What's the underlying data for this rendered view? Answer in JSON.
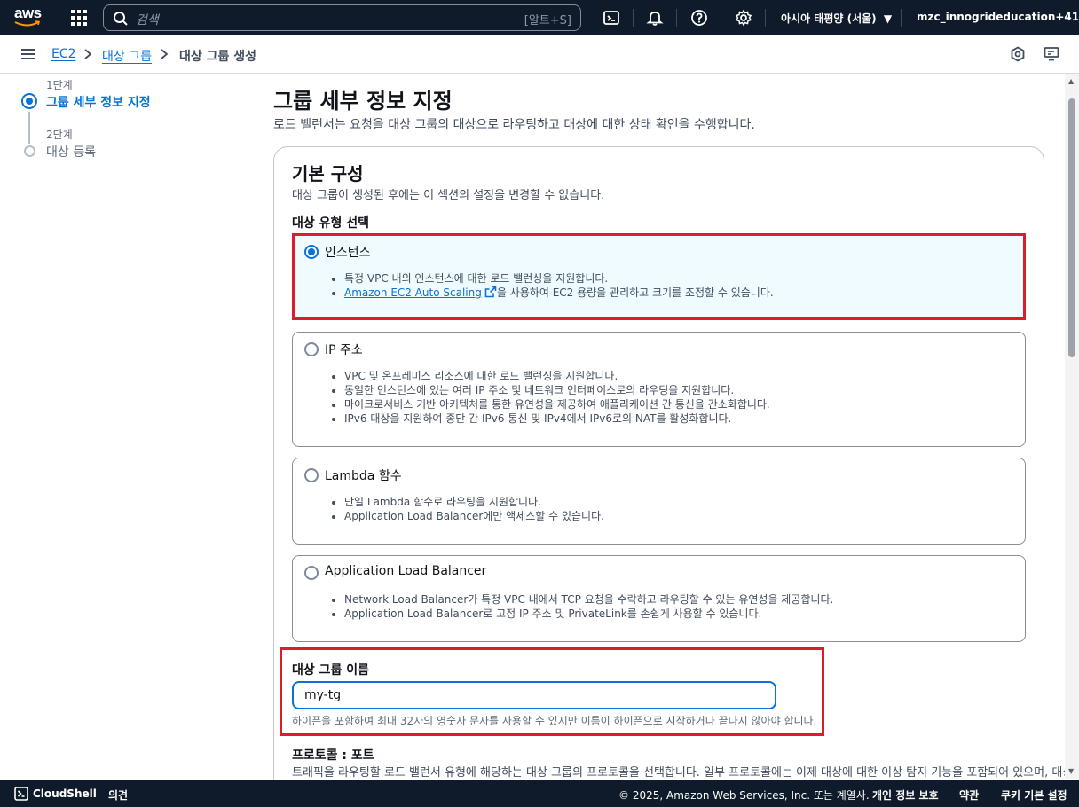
{
  "topnav": {
    "logo_text": "aws",
    "search_placeholder": "검색",
    "search_shortcut": "[알트+S]",
    "region": "아시아 태평양 (서울)",
    "account": "mzc_innogrideducation+41"
  },
  "breadcrumb": {
    "items": [
      "EC2",
      "대상 그룹",
      "대상 그룹 생성"
    ]
  },
  "steps": [
    {
      "number": "1단계",
      "label": "그룹 세부 정보 지정"
    },
    {
      "number": "2단계",
      "label": "대상 등록"
    }
  ],
  "main": {
    "title": "그룹 세부 정보 지정",
    "description": "로드 밸런서는 요청을 대상 그룹의 대상으로 라우팅하고 대상에 대한 상태 확인을 수행합니다."
  },
  "basic_config": {
    "title": "기본 구성",
    "description": "대상 그룹이 생성된 후에는 이 섹션의 설정을 변경할 수 없습니다.",
    "target_type_label": "대상 유형 선택",
    "options": [
      {
        "title": "인스턴스",
        "selected": true,
        "bullets": [
          "특정 VPC 내의 인스턴스에 대한 로드 밸런싱을 지원합니다."
        ],
        "link_text": "Amazon EC2 Auto Scaling",
        "link_suffix": "을 사용하여 EC2 용량을 관리하고 크기를 조정할 수 있습니다."
      },
      {
        "title": "IP 주소",
        "selected": false,
        "bullets": [
          "VPC 및 온프레미스 리소스에 대한 로드 밸런싱을 지원합니다.",
          "동일한 인스턴스에 있는 여러 IP 주소 및 네트워크 인터페이스로의 라우팅을 지원합니다.",
          "마이크로서비스 기반 아키텍처를 통한 유연성을 제공하여 애플리케이션 간 통신을 간소화합니다.",
          "IPv6 대상을 지원하여 종단 간 IPv6 통신 및 IPv4에서 IPv6로의 NAT를 활성화합니다."
        ]
      },
      {
        "title": "Lambda 함수",
        "selected": false,
        "bullets": [
          "단일 Lambda 함수로 라우팅을 지원합니다.",
          "Application Load Balancer에만 액세스할 수 있습니다."
        ]
      },
      {
        "title": "Application Load Balancer",
        "selected": false,
        "bullets": [
          "Network Load Balancer가 특정 VPC 내에서 TCP 요청을 수락하고 라우팅할 수 있는 유연성을 제공합니다.",
          "Application Load Balancer로 고정 IP 주소 및 PrivateLink를 손쉽게 사용할 수 있습니다."
        ]
      }
    ],
    "name_label": "대상 그룹 이름",
    "name_value": "my-tg",
    "name_hint": "하이픈을 포함하여 최대 32자의 영숫자 문자를 사용할 수 있지만 이름이 하이픈으로 시작하거나 끝나지 않아야 합니다.",
    "protocol_label": "프로토콜 : 포트",
    "protocol_desc": "트래픽을 라우팅할 로드 밸런서 유형에 해당하는 대상 그룹의 프로토콜을 선택합니다. 일부 프로토콜에는 이제 대상에 대한 이상 탐지 기능을 포함되어 있으며, 대상 그"
  },
  "footer": {
    "cloudshell": "CloudShell",
    "feedback": "의견",
    "copyright": "© 2025, Amazon Web Services, Inc. 또는 계열사.",
    "privacy": "개인 정보 보호",
    "terms": "약관",
    "cookies": "쿠키 기본 설정"
  },
  "colors": {
    "nav_bg": "#0f1b2a",
    "link": "#0972d3",
    "highlight_border": "#d91d2c",
    "selected_tile_bg": "#f0fbff"
  }
}
